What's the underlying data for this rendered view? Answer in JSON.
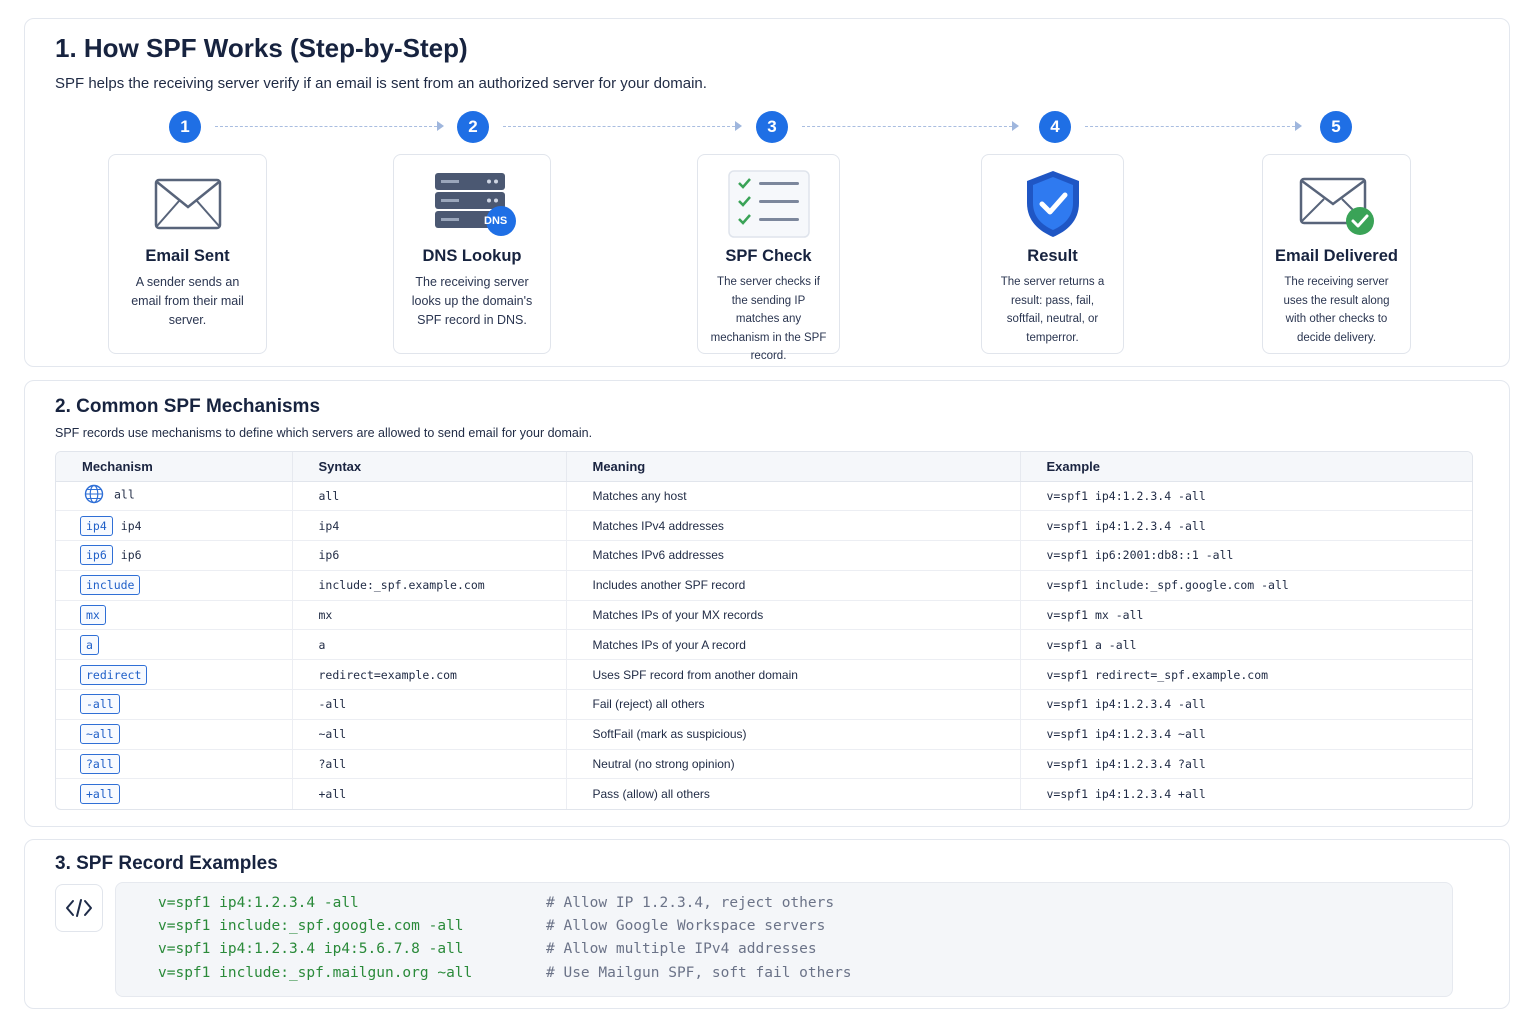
{
  "section1": {
    "title": "1.  How SPF Works (Step-by-Step)",
    "subtitle": "SPF helps the receiving server verify if an email is sent from an authorized server for your domain.",
    "steps": [
      {
        "num": "1",
        "title": "Email Sent",
        "desc": "A sender sends an email from their mail server.",
        "icon": "envelope-icon"
      },
      {
        "num": "2",
        "title": "DNS Lookup",
        "desc": "The receiving server looks up the domain's SPF record in DNS.",
        "icon": "dns-server-icon",
        "badge": "DNS"
      },
      {
        "num": "3",
        "title": "SPF Check",
        "desc": "The server checks if the sending IP matches any mechanism in the SPF record.",
        "icon": "checklist-icon"
      },
      {
        "num": "4",
        "title": "Result",
        "desc": "The server returns a result: pass, fail, softfail, neutral, or temperror.",
        "icon": "shield-check-icon"
      },
      {
        "num": "5",
        "title": "Email Delivered",
        "desc": "The receiving server uses the result along with other checks to decide delivery.",
        "icon": "envelope-check-icon"
      }
    ]
  },
  "section2": {
    "title": "2.  Common SPF Mechanisms",
    "subtitle": "SPF records use mechanisms to define which servers are allowed to send email for your domain.",
    "headers": [
      "Mechanism",
      "Syntax",
      "Meaning",
      "Example"
    ],
    "rows": [
      {
        "icon": "globe-icon",
        "badge": "",
        "label": "all",
        "syntax": "all",
        "meaning": "Matches any host",
        "example": "v=spf1 ip4:1.2.3.4 -all"
      },
      {
        "badge": "ip4",
        "label": "ip4",
        "syntax": "ip4",
        "meaning": "Matches IPv4 addresses",
        "example": "v=spf1 ip4:1.2.3.4 -all"
      },
      {
        "badge": "ip6",
        "label": "ip6",
        "syntax": "ip6",
        "meaning": "Matches IPv6 addresses",
        "example": "v=spf1 ip6:2001:db8::1 -all"
      },
      {
        "badge": "include",
        "label": "",
        "syntax": "include:_spf.example.com",
        "meaning": "Includes another SPF record",
        "example": "v=spf1 include:_spf.google.com -all"
      },
      {
        "badge": "mx",
        "label": "",
        "syntax": "mx",
        "meaning": "Matches IPs of your MX records",
        "example": "v=spf1 mx -all"
      },
      {
        "badge": "a",
        "label": "",
        "syntax": "a",
        "meaning": "Matches IPs of your A record",
        "example": "v=spf1 a -all"
      },
      {
        "badge": "redirect",
        "label": "",
        "syntax": "redirect=example.com",
        "meaning": "Uses SPF record from another domain",
        "example": "v=spf1 redirect=_spf.example.com"
      },
      {
        "badge": "-all",
        "label": "",
        "syntax": "-all",
        "meaning": "Fail (reject) all others",
        "example": "v=spf1 ip4:1.2.3.4 -all"
      },
      {
        "badge": "~all",
        "label": "",
        "syntax": "~all",
        "meaning": "SoftFail (mark as suspicious)",
        "example": "v=spf1 ip4:1.2.3.4 ~all"
      },
      {
        "badge": "?all",
        "label": "",
        "syntax": "?all",
        "meaning": "Neutral (no strong opinion)",
        "example": "v=spf1 ip4:1.2.3.4 ?all"
      },
      {
        "badge": "+all",
        "label": "",
        "syntax": "+all",
        "meaning": "Pass (allow) all others",
        "example": "v=spf1 ip4:1.2.3.4 +all"
      }
    ]
  },
  "section3": {
    "title": "3.  SPF Record Examples",
    "icon": "code-icon",
    "lines": [
      {
        "code": "v=spf1 ip4:1.2.3.4 -all",
        "comment": "# Allow IP 1.2.3.4, reject others"
      },
      {
        "code": "v=spf1 include:_spf.google.com -all",
        "comment": "# Allow Google Workspace servers"
      },
      {
        "code": "v=spf1 ip4:1.2.3.4 ip4:5.6.7.8 -all",
        "comment": "# Allow multiple IPv4 addresses"
      },
      {
        "code": "v=spf1 include:_spf.mailgun.org ~all",
        "comment": "# Use Mailgun SPF, soft fail others"
      }
    ]
  },
  "colors": {
    "accent": "#1f6fe5",
    "code_green": "#2a8a3a",
    "check_green": "#3aa357"
  }
}
